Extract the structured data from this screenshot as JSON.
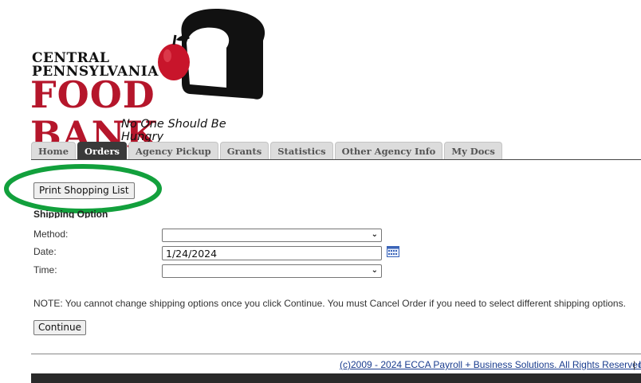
{
  "logo": {
    "line1": "CENTRAL",
    "line2": "PENNSYLVANIA",
    "line3": "FOOD BANK",
    "tagline": "No One Should Be Hungry"
  },
  "tabs": [
    {
      "label": "Home",
      "active": false
    },
    {
      "label": "Orders",
      "active": true
    },
    {
      "label": "Agency Pickup",
      "active": false
    },
    {
      "label": "Grants",
      "active": false
    },
    {
      "label": "Statistics",
      "active": false
    },
    {
      "label": "Other Agency Info",
      "active": false
    },
    {
      "label": "My Docs",
      "active": false
    }
  ],
  "print_button_label": "Print Shopping List",
  "shipping": {
    "title": "Shipping Option",
    "method_label": "Method:",
    "method_value": "",
    "date_label": "Date:",
    "date_value": "1/24/2024",
    "time_label": "Time:",
    "time_value": ""
  },
  "note": "NOTE: You cannot change shipping options once you click Continue. You must Cancel Order if you need to select different shipping options.",
  "continue_label": "Continue",
  "footer": {
    "copyright": "(c)2009 - 2024 ECCA Payroll + Business Solutions. All Rights Reserved",
    "separator": "|",
    "more": "I"
  },
  "colors": {
    "brand_red": "#b5162b",
    "highlight_green": "#12a03c",
    "active_tab": "#3a3a3a",
    "link": "#1a3d8f"
  }
}
